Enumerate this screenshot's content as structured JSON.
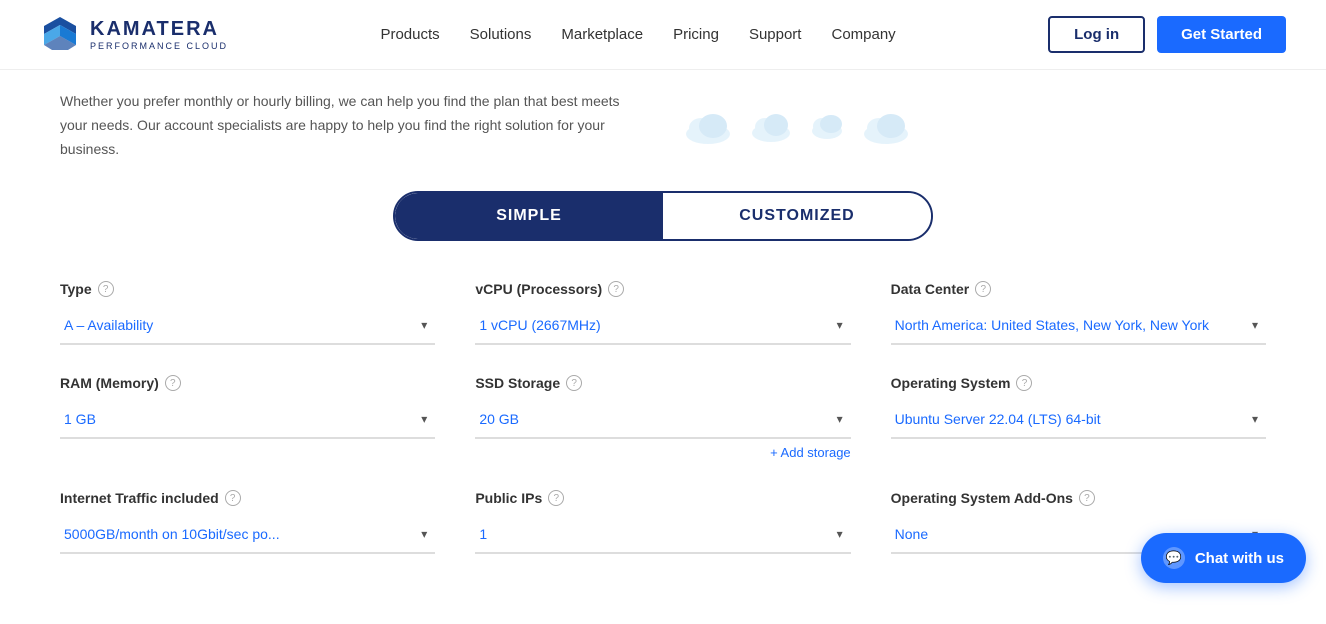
{
  "header": {
    "logo_main": "KAMATERA",
    "logo_sub": "PERFORMANCE CLOUD",
    "nav_items": [
      "Products",
      "Solutions",
      "Marketplace",
      "Pricing",
      "Support",
      "Company"
    ],
    "login_label": "Log in",
    "get_started_label": "Get Started"
  },
  "top": {
    "description": "Whether you prefer monthly or hourly billing, we can help you find the plan that best meets your needs. Our account specialists are happy to help you find the right solution for your business."
  },
  "toggle": {
    "simple_label": "SIMPLE",
    "customized_label": "CUSTOMIZED"
  },
  "config": {
    "type": {
      "label": "Type",
      "value": "A – Availability"
    },
    "vcpu": {
      "label": "vCPU (Processors)",
      "value": "1 vCPU (2667MHz)"
    },
    "datacenter": {
      "label": "Data Center",
      "value": "North America: United States, New York, New York"
    },
    "ram": {
      "label": "RAM (Memory)",
      "value": "1 GB"
    },
    "ssd": {
      "label": "SSD Storage",
      "value": "20 GB"
    },
    "os": {
      "label": "Operating System",
      "value": "Ubuntu Server 22.04 (LTS) 64-bit"
    },
    "add_storage": "+ Add storage",
    "internet": {
      "label": "Internet Traffic included",
      "value": "5000GB/month on 10Gbit/sec po..."
    },
    "public_ips": {
      "label": "Public IPs",
      "value": "1"
    },
    "os_addons": {
      "label": "Operating System Add-Ons",
      "value": "None"
    }
  },
  "chat": {
    "label": "Chat with us"
  },
  "icons": {
    "help": "?",
    "chevron_down": "▾",
    "chat": "💬"
  }
}
